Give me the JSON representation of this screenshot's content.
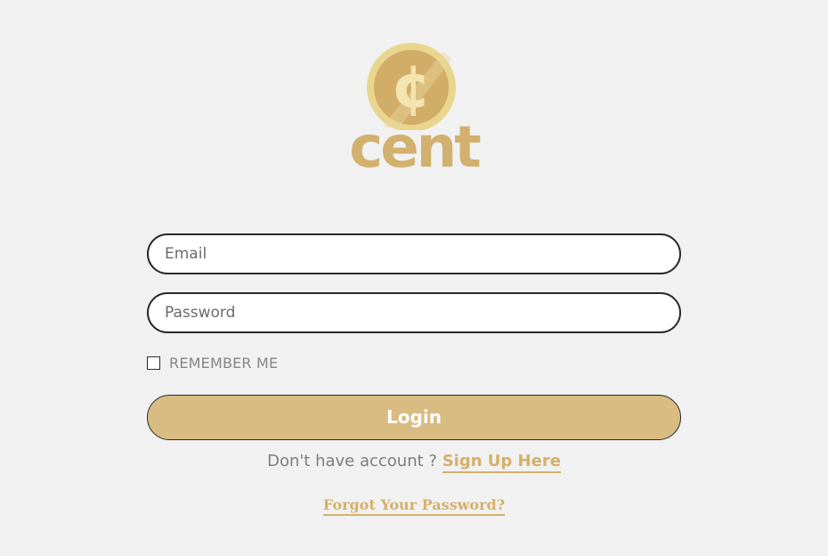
{
  "brand": {
    "coin_symbol": "¢",
    "wordmark": "cent",
    "colors": {
      "coin_outer": "#e6d38f",
      "coin_inner": "#d4b06c",
      "wordmark": "#d2b06e"
    }
  },
  "form": {
    "email_placeholder": "Email",
    "password_placeholder": "Password",
    "remember_label": "REMEMBER ME",
    "remember_checked": false,
    "login_label": "Login"
  },
  "signup": {
    "prompt": "Don't have account ? ",
    "link_label": "Sign Up Here"
  },
  "forgot": {
    "link_label": "Forgot Your Password?"
  },
  "theme": {
    "background": "#f1f1f1",
    "accent": "#d9bc82",
    "link": "#d5b069"
  }
}
